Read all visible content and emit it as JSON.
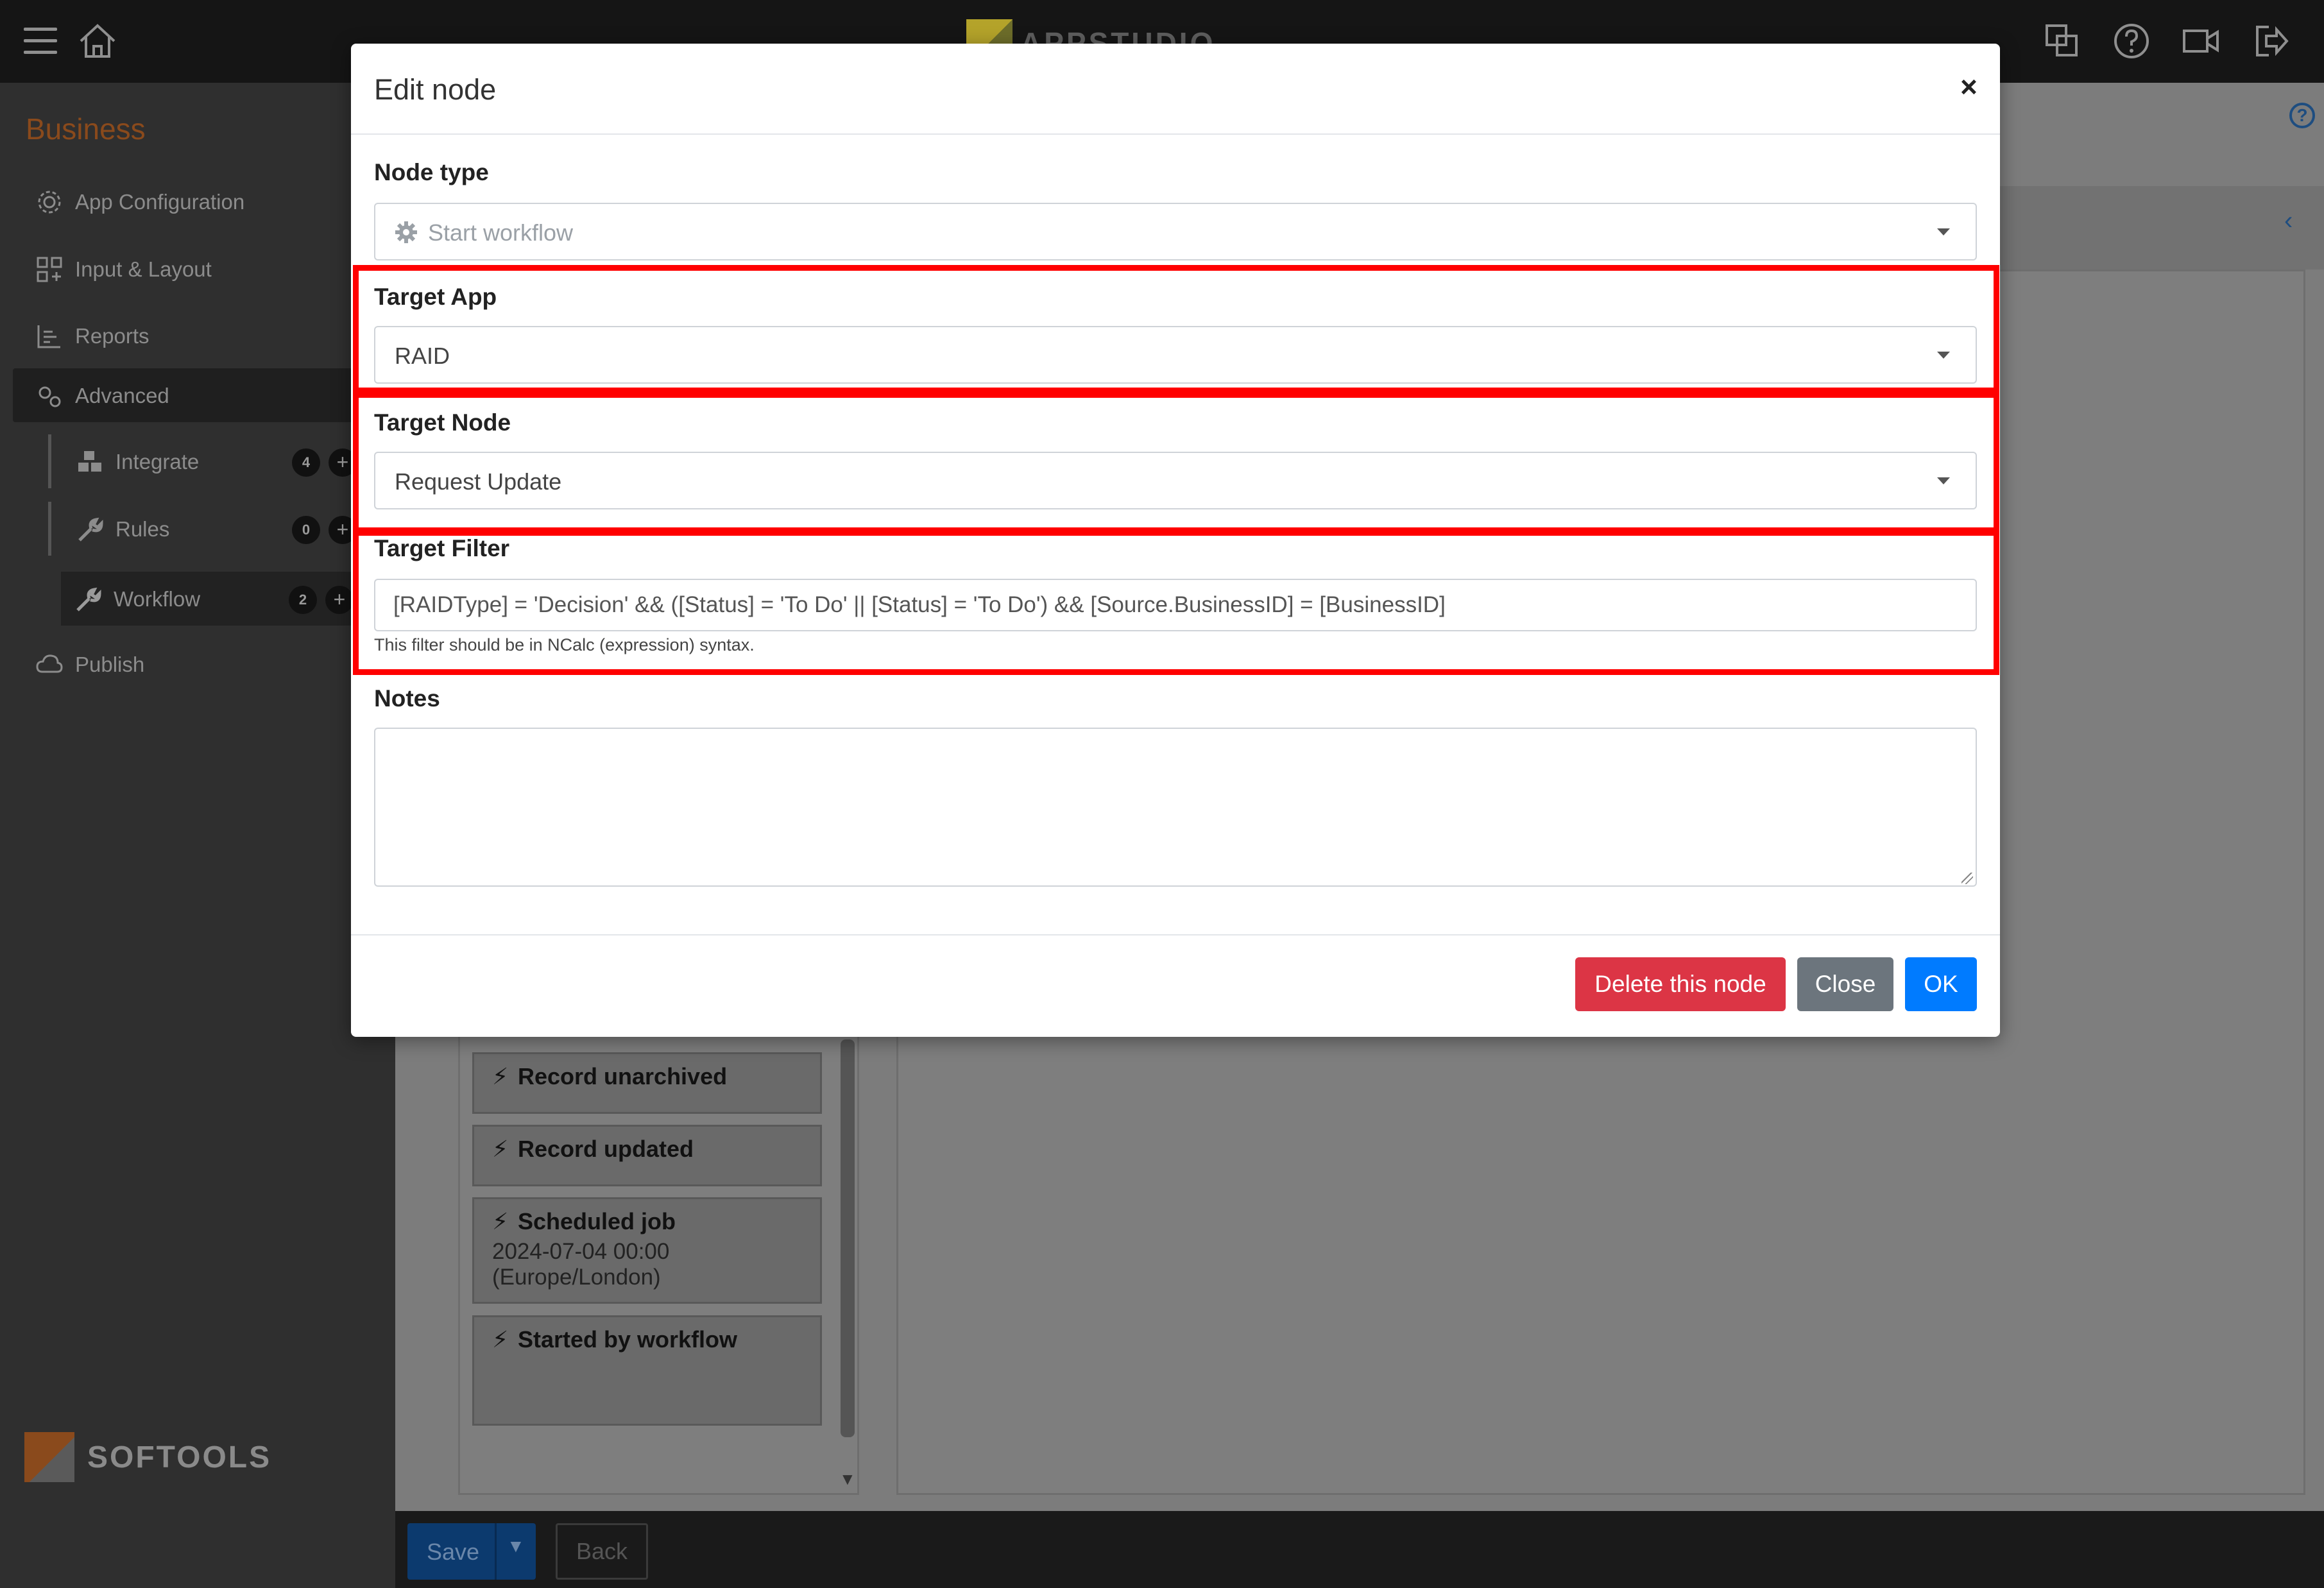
{
  "app": {
    "brand_text": "APPSTUDIO",
    "section_title": "Business",
    "footer_brand": "SOFTOOLS"
  },
  "sidebar": {
    "items": [
      {
        "label": "App Configuration",
        "icon": "gear-icon"
      },
      {
        "label": "Input & Layout",
        "icon": "grid-icon"
      },
      {
        "label": "Reports",
        "icon": "report-icon"
      },
      {
        "label": "Advanced",
        "icon": "cogs-icon"
      },
      {
        "label": "Publish",
        "icon": "cloud-icon"
      }
    ],
    "subitems": [
      {
        "label": "Integrate",
        "count": "4",
        "icon": "cubes-icon"
      },
      {
        "label": "Rules",
        "count": "0",
        "icon": "wrench-icon"
      },
      {
        "label": "Workflow",
        "count": "2",
        "icon": "wrench-icon"
      }
    ]
  },
  "triggers": [
    {
      "label": "Record unarchived"
    },
    {
      "label": "Record updated"
    },
    {
      "label": "Scheduled job",
      "detail_line1": "2024-07-04 00:00",
      "detail_line2": "(Europe/London)"
    },
    {
      "label": "Started by workflow"
    }
  ],
  "bottom": {
    "save_label": "Save",
    "back_label": "Back"
  },
  "modal": {
    "title": "Edit node",
    "close_glyph": "×",
    "node_type": {
      "label": "Node type",
      "value": "Start workflow"
    },
    "target_app": {
      "label": "Target App",
      "value": "RAID"
    },
    "target_node": {
      "label": "Target Node",
      "value": "Request Update"
    },
    "target_filter": {
      "label": "Target Filter",
      "value": "[RAIDType] = 'Decision' && ([Status] = 'To Do' || [Status] = 'To Do') && [Source.BusinessID] = [BusinessID]",
      "hint": "This filter should be in NCalc (expression) syntax."
    },
    "notes": {
      "label": "Notes",
      "value": ""
    },
    "buttons": {
      "delete": "Delete this node",
      "close": "Close",
      "ok": "OK"
    }
  },
  "colors": {
    "highlight": "#ff0000",
    "danger": "#dc3545",
    "secondary": "#6c757d",
    "primary": "#007bff"
  }
}
